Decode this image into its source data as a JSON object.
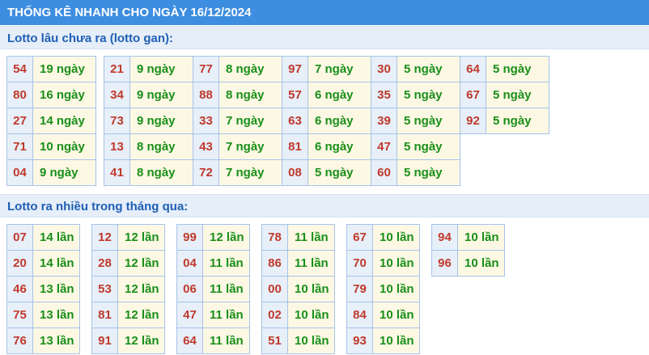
{
  "header": {
    "title": "THỐNG KÊ NHANH CHO NGÀY 16/12/2024"
  },
  "sections": [
    {
      "title": "Lotto lâu chưa ra (lotto gan):",
      "columns": [
        [
          [
            "54",
            "19 ngày"
          ],
          [
            "80",
            "16 ngày"
          ],
          [
            "27",
            "14 ngày"
          ],
          [
            "71",
            "10 ngày"
          ],
          [
            "04",
            "9 ngày"
          ]
        ],
        [
          [
            "21",
            "9 ngày"
          ],
          [
            "34",
            "9 ngày"
          ],
          [
            "73",
            "9 ngày"
          ],
          [
            "13",
            "8 ngày"
          ],
          [
            "41",
            "8 ngày"
          ]
        ],
        [
          [
            "77",
            "8 ngày"
          ],
          [
            "88",
            "8 ngày"
          ],
          [
            "33",
            "7 ngày"
          ],
          [
            "43",
            "7 ngày"
          ],
          [
            "72",
            "7 ngày"
          ]
        ],
        [
          [
            "97",
            "7 ngày"
          ],
          [
            "57",
            "6 ngày"
          ],
          [
            "63",
            "6 ngày"
          ],
          [
            "81",
            "6 ngày"
          ],
          [
            "08",
            "5 ngày"
          ]
        ],
        [
          [
            "30",
            "5 ngày"
          ],
          [
            "35",
            "5 ngày"
          ],
          [
            "39",
            "5 ngày"
          ],
          [
            "47",
            "5 ngày"
          ],
          [
            "60",
            "5 ngày"
          ]
        ],
        [
          [
            "64",
            "5 ngày"
          ],
          [
            "67",
            "5 ngày"
          ],
          [
            "92",
            "5 ngày"
          ]
        ]
      ]
    },
    {
      "title": "Lotto ra nhiều trong tháng qua:",
      "columns": [
        [
          [
            "07",
            "14 lần"
          ],
          [
            "20",
            "14 lần"
          ],
          [
            "46",
            "13 lần"
          ],
          [
            "75",
            "13 lần"
          ],
          [
            "76",
            "13 lần"
          ]
        ],
        [
          [
            "12",
            "12 lần"
          ],
          [
            "28",
            "12 lần"
          ],
          [
            "53",
            "12 lần"
          ],
          [
            "81",
            "12 lần"
          ],
          [
            "91",
            "12 lần"
          ]
        ],
        [
          [
            "99",
            "12 lần"
          ],
          [
            "04",
            "11 lần"
          ],
          [
            "06",
            "11 lần"
          ],
          [
            "47",
            "11 lần"
          ],
          [
            "64",
            "11 lần"
          ]
        ],
        [
          [
            "78",
            "11 lần"
          ],
          [
            "86",
            "11 lần"
          ],
          [
            "00",
            "10 lần"
          ],
          [
            "02",
            "10 lần"
          ],
          [
            "51",
            "10 lần"
          ]
        ],
        [
          [
            "67",
            "10 lần"
          ],
          [
            "70",
            "10 lần"
          ],
          [
            "79",
            "10 lần"
          ],
          [
            "84",
            "10 lần"
          ],
          [
            "93",
            "10 lần"
          ]
        ],
        [
          [
            "94",
            "10 lần"
          ],
          [
            "96",
            "10 lần"
          ]
        ]
      ]
    }
  ]
}
